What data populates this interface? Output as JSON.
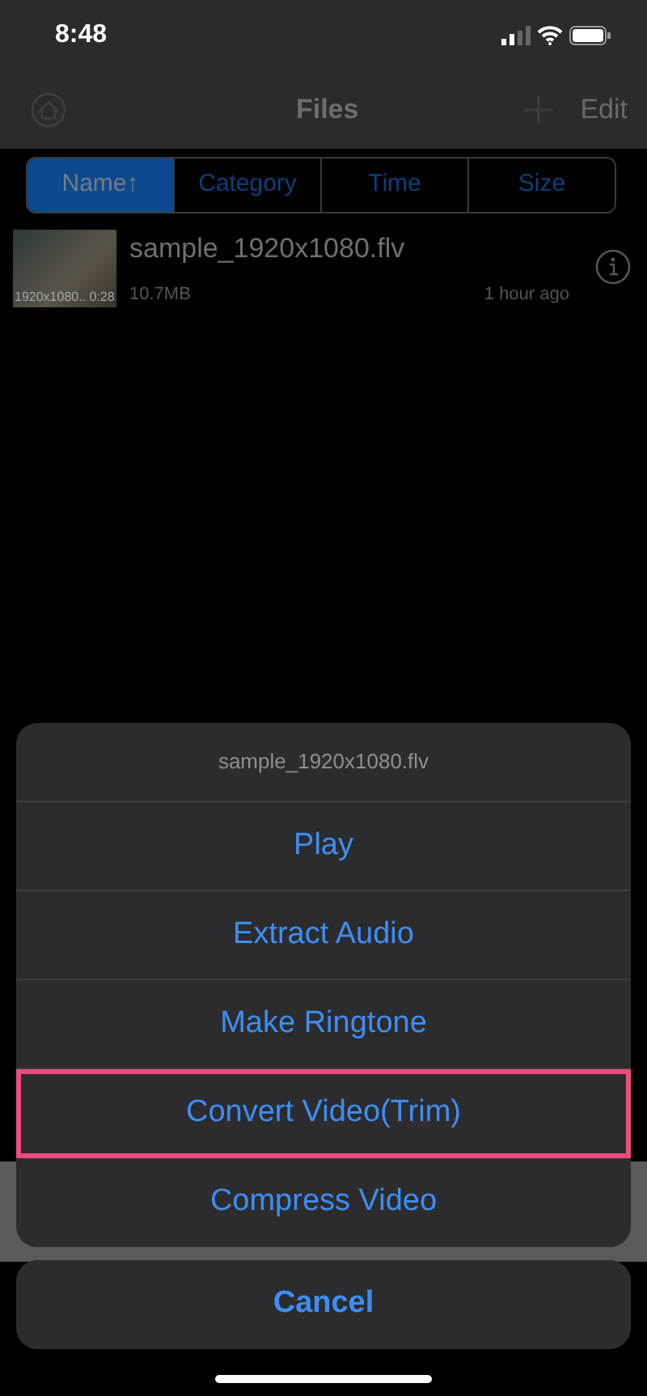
{
  "status_bar": {
    "time": "8:48"
  },
  "nav_bar": {
    "title": "Files",
    "right_action": "Edit"
  },
  "sort_tabs": [
    {
      "label": "Name↑",
      "selected": true
    },
    {
      "label": "Category",
      "selected": false
    },
    {
      "label": "Time",
      "selected": false
    },
    {
      "label": "Size",
      "selected": false
    }
  ],
  "files": [
    {
      "name": "sample_1920x1080.flv",
      "thumbnail_caption": "1920x1080.. 0:28",
      "size": "10.7MB",
      "time": "1 hour ago"
    }
  ],
  "action_sheet": {
    "title": "sample_1920x1080.flv",
    "actions": [
      {
        "label": "Play",
        "highlighted": false
      },
      {
        "label": "Extract Audio",
        "highlighted": false
      },
      {
        "label": "Make Ringtone",
        "highlighted": false
      },
      {
        "label": "Convert Video(Trim)",
        "highlighted": true
      },
      {
        "label": "Compress Video",
        "highlighted": false
      }
    ],
    "cancel": "Cancel"
  }
}
